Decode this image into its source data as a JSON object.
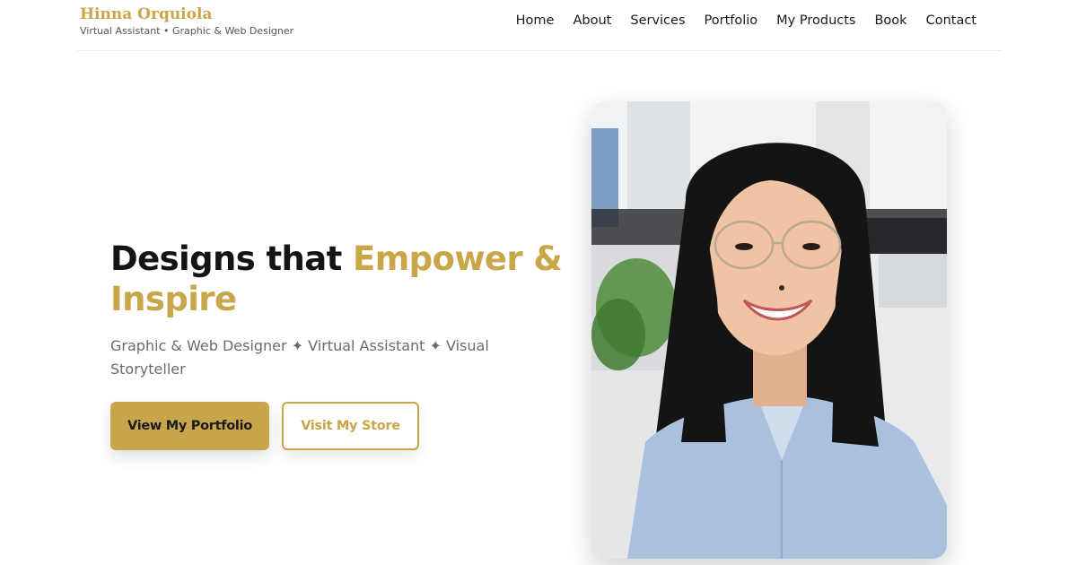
{
  "brand": {
    "name": "Hinna Orquiola",
    "tagline": "Virtual Assistant • Graphic & Web Designer"
  },
  "nav": {
    "items": [
      "Home",
      "About",
      "Services",
      "Portfolio",
      "My Products",
      "Book",
      "Contact"
    ]
  },
  "hero": {
    "title_plain": "Designs that ",
    "title_accent": "Empower & Inspire",
    "subtitle": "Graphic & Web Designer ✦ Virtual Assistant ✦ Visual Storyteller",
    "primary_button": "View My Portfolio",
    "secondary_button": "Visit My Store"
  },
  "colors": {
    "accent": "#c9a647",
    "text": "#141414",
    "muted": "#6b6b6b"
  },
  "photo": {
    "icon": "portrait-photo"
  }
}
